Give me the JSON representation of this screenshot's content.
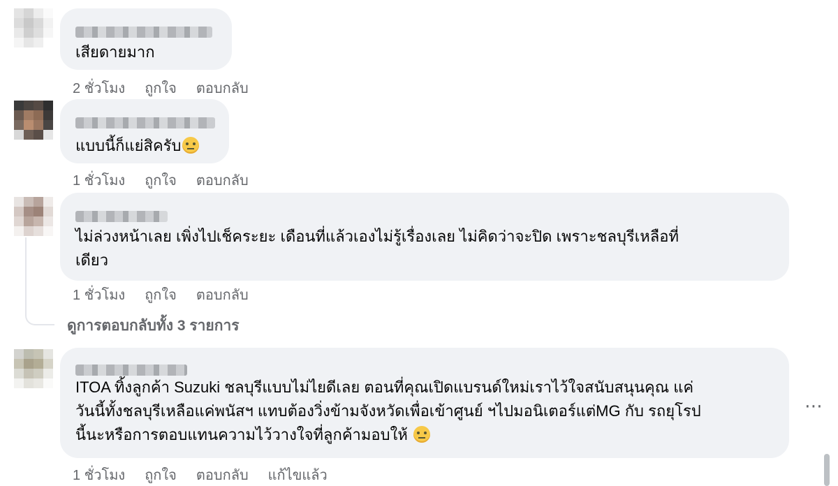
{
  "comments": [
    {
      "text": "เสียดายมาก",
      "time": "2 ชั่วโมง",
      "like": "ถูกใจ",
      "reply": "ตอบกลับ"
    },
    {
      "text": "แบบนี้ก็แย่สิครับ",
      "emoji": "face-with-rolling-eyes",
      "time": "1 ชั่วโมง",
      "like": "ถูกใจ",
      "reply": "ตอบกลับ"
    },
    {
      "text": "ไม่ล่วงหน้าเลย เพิ่งไปเช็คระยะ เดือนที่แล้วเองไม่รู้เรื่องเลย ไม่คิดว่าจะปิด เพราะชลบุรีเหลือที่\nเดียว",
      "time": "1 ชั่วโมง",
      "like": "ถูกใจ",
      "reply": "ตอบกลับ"
    },
    {
      "text": "ITOA ทิ้งลูกค้า Suzuki ชลบุรีแบบไม่ไยดีเลย ตอนที่คุณเปิดแบรนด์ใหม่เราไว้ใจสนับสนุนคุณ แค่\nวันนี้ทั้งชลบุรีเหลือแค่พนัสฯ แทบต้องวิ่งข้ามจังหวัดเพื่อเข้าศูนย์ ฯไปมอนิเตอร์แต่MG กับ รถยุโรป\nนี้นะหรือการตอบแทนความไว้วางใจที่ลูกค้ามอบให้",
      "emoji": "expressionless-face",
      "time": "1 ชั่วโมง",
      "like": "ถูกใจ",
      "reply": "ตอบกลับ",
      "edited": "แก้ไขแล้ว"
    }
  ],
  "view_replies": "ดูการตอบกลับทั้ง 3 รายการ",
  "more_icon": "⋯"
}
